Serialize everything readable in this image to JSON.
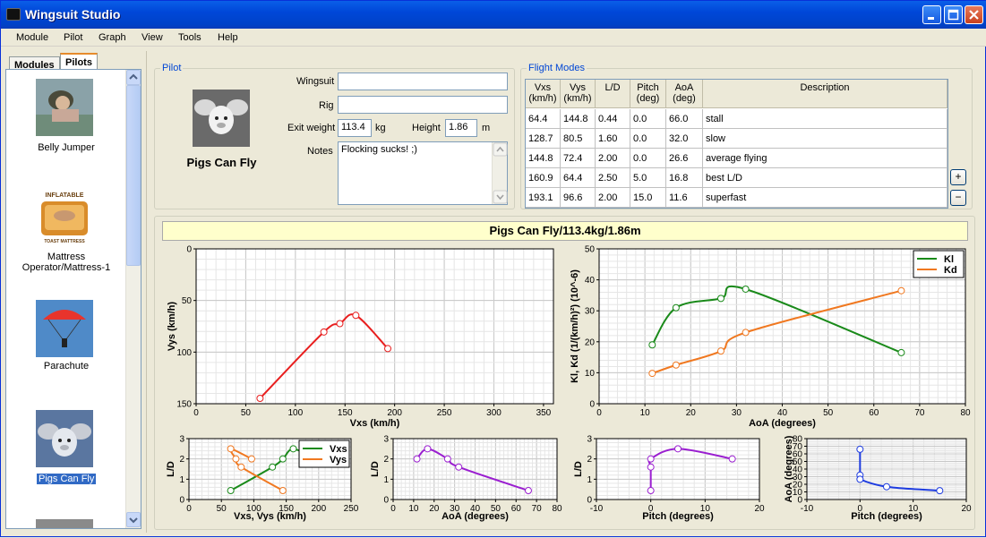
{
  "window": {
    "title": "Wingsuit Studio"
  },
  "menu": [
    "Module",
    "Pilot",
    "Graph",
    "View",
    "Tools",
    "Help"
  ],
  "left_tabs": [
    "Modules",
    "Pilots"
  ],
  "pilots": [
    {
      "name": "Belly Jumper",
      "icon": "belly-jumper-photo"
    },
    {
      "name": "Mattress Operator/Mattress-1",
      "label_line1": "Mattress",
      "label_line2": "Operator/Mattress-1",
      "icon": "mattress-photo",
      "logo_top": "INFLATABLE",
      "logo_bottom": "TOAST MATTRESS"
    },
    {
      "name": "Parachute",
      "icon": "parachute-photo"
    },
    {
      "name": "Pigs Can Fly",
      "icon": "flying-pig-photo",
      "selected": true
    }
  ],
  "pilot_group": {
    "title": "Pilot",
    "pilot_name": "Pigs Can Fly",
    "wingsuit_label": "Wingsuit",
    "wingsuit_value": "",
    "rig_label": "Rig",
    "rig_value": "",
    "exit_weight_label": "Exit weight",
    "exit_weight_value": "113.4",
    "exit_weight_unit": "kg",
    "height_label": "Height",
    "height_value": "1.86",
    "height_unit": "m",
    "notes_label": "Notes",
    "notes_value": "Flocking sucks! ;)"
  },
  "flight_modes": {
    "title": "Flight Modes",
    "columns": [
      [
        "Vxs",
        "(km/h)"
      ],
      [
        "Vys",
        "(km/h)"
      ],
      [
        "L/D",
        ""
      ],
      [
        "Pitch",
        "(deg)"
      ],
      [
        "AoA",
        "(deg)"
      ],
      [
        "Description",
        ""
      ]
    ],
    "rows": [
      [
        "64.4",
        "144.8",
        "0.44",
        "0.0",
        "66.0",
        "stall"
      ],
      [
        "128.7",
        "80.5",
        "1.60",
        "0.0",
        "32.0",
        "slow"
      ],
      [
        "144.8",
        "72.4",
        "2.00",
        "0.0",
        "26.6",
        "average flying"
      ],
      [
        "160.9",
        "64.4",
        "2.50",
        "5.0",
        "16.8",
        "best L/D"
      ],
      [
        "193.1",
        "96.6",
        "2.00",
        "15.0",
        "11.6",
        "superfast"
      ]
    ],
    "add_button": "+",
    "remove_button": "−"
  },
  "graph_title": "Pigs Can Fly/113.4kg/1.86m",
  "chart_data": [
    {
      "type": "line",
      "id": "polar",
      "xlabel": "Vxs (km/h)",
      "ylabel": "Vys (km/h)",
      "xlim": [
        0,
        360
      ],
      "ylim": [
        150,
        0
      ],
      "xticks": [
        0,
        50,
        100,
        150,
        200,
        250,
        300,
        350
      ],
      "yticks": [
        0,
        50,
        100,
        150
      ],
      "grid": true,
      "series": [
        {
          "color": "#e81e1e",
          "x": [
            64.4,
            128.7,
            144.8,
            160.9,
            193.1
          ],
          "y": [
            144.8,
            80.5,
            72.4,
            64.4,
            96.6
          ]
        }
      ]
    },
    {
      "type": "line",
      "id": "coeffs",
      "xlabel": "AoA (degrees)",
      "ylabel": "Kl, Kd (1/(km/h)²) (10^-6)",
      "xlim": [
        0,
        80
      ],
      "ylim": [
        0,
        50
      ],
      "xticks": [
        0,
        10,
        20,
        30,
        40,
        50,
        60,
        70,
        80
      ],
      "yticks": [
        0,
        10,
        20,
        30,
        40,
        50
      ],
      "grid": true,
      "legend": "top-right",
      "series": [
        {
          "name": "Kl",
          "color": "#1a8a1a",
          "x": [
            11.6,
            16.8,
            26.6,
            32.0,
            66.0
          ],
          "y": [
            19,
            31,
            34,
            37,
            16.5
          ]
        },
        {
          "name": "Kd",
          "color": "#f07820",
          "x": [
            11.6,
            16.8,
            26.6,
            32.0,
            66.0
          ],
          "y": [
            9.8,
            12.5,
            17,
            23,
            36.5
          ]
        }
      ]
    },
    {
      "type": "line",
      "id": "ld_speed",
      "xlabel": "Vxs, Vys (km/h)",
      "ylabel": "L/D",
      "xlim": [
        0,
        250
      ],
      "ylim": [
        0,
        3
      ],
      "xticks": [
        0,
        50,
        100,
        150,
        200,
        250
      ],
      "yticks": [
        0,
        1,
        2,
        3
      ],
      "grid": true,
      "legend": "top-right",
      "series": [
        {
          "name": "Vxs",
          "color": "#1a8a1a",
          "x": [
            64.4,
            128.7,
            144.8,
            160.9,
            193.1
          ],
          "y": [
            0.44,
            1.6,
            2.0,
            2.5,
            2.0
          ]
        },
        {
          "name": "Vys",
          "color": "#f07820",
          "x": [
            144.8,
            80.5,
            72.4,
            64.4,
            96.6
          ],
          "y": [
            0.44,
            1.6,
            2.0,
            2.5,
            2.0
          ]
        }
      ]
    },
    {
      "type": "line",
      "id": "ld_aoa",
      "xlabel": "AoA (degrees)",
      "ylabel": "L/D",
      "xlim": [
        0,
        80
      ],
      "ylim": [
        0,
        3
      ],
      "xticks": [
        0,
        10,
        20,
        30,
        40,
        50,
        60,
        70,
        80
      ],
      "yticks": [
        0,
        1,
        2,
        3
      ],
      "grid": true,
      "series": [
        {
          "color": "#9a1ed0",
          "x": [
            11.6,
            16.8,
            26.6,
            32.0,
            66.0
          ],
          "y": [
            2.0,
            2.5,
            2.0,
            1.6,
            0.44
          ]
        }
      ]
    },
    {
      "type": "line",
      "id": "ld_pitch",
      "xlabel": "Pitch (degrees)",
      "ylabel": "L/D",
      "xlim": [
        -10,
        20
      ],
      "ylim": [
        0,
        3
      ],
      "xticks": [
        -10,
        0,
        10,
        20
      ],
      "yticks": [
        0,
        1,
        2,
        3
      ],
      "grid": true,
      "series": [
        {
          "color": "#9a1ed0",
          "x": [
            0,
            0,
            0,
            5,
            15
          ],
          "y": [
            0.44,
            1.6,
            2.0,
            2.5,
            2.0
          ]
        }
      ]
    },
    {
      "type": "line",
      "id": "aoa_pitch",
      "xlabel": "Pitch (degrees)",
      "ylabel": "AoA (degrees)",
      "xlim": [
        -10,
        20
      ],
      "ylim": [
        0,
        80
      ],
      "xticks": [
        -10,
        0,
        10,
        20
      ],
      "yticks": [
        0,
        10,
        20,
        30,
        40,
        50,
        60,
        70,
        80
      ],
      "grid": true,
      "series": [
        {
          "color": "#1e3ce0",
          "x": [
            0,
            0,
            0,
            5,
            15
          ],
          "y": [
            66.0,
            32.0,
            26.6,
            16.8,
            11.6
          ]
        }
      ]
    }
  ]
}
